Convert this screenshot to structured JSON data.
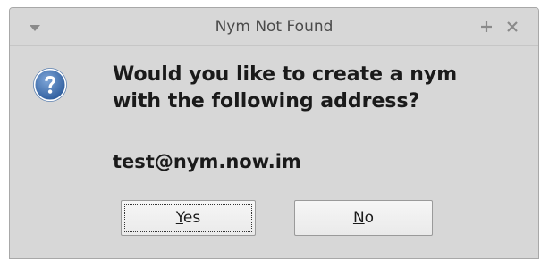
{
  "window": {
    "title": "Nym Not Found"
  },
  "icons": {
    "menu": "chevron-down-icon",
    "maximize": "plus-icon",
    "close": "close-icon",
    "dialog": "question-icon"
  },
  "dialog": {
    "message_line1": "Would you like to create a nym",
    "message_line2": "with the following address?",
    "address": "test@nym.now.im"
  },
  "buttons": {
    "yes": {
      "mnemonic": "Y",
      "rest": "es"
    },
    "no": {
      "mnemonic": "N",
      "rest": "o"
    }
  },
  "colors": {
    "window_bg": "#d7d7d7",
    "icon_blue": "#3f6fae",
    "text": "#1a1a1a"
  }
}
